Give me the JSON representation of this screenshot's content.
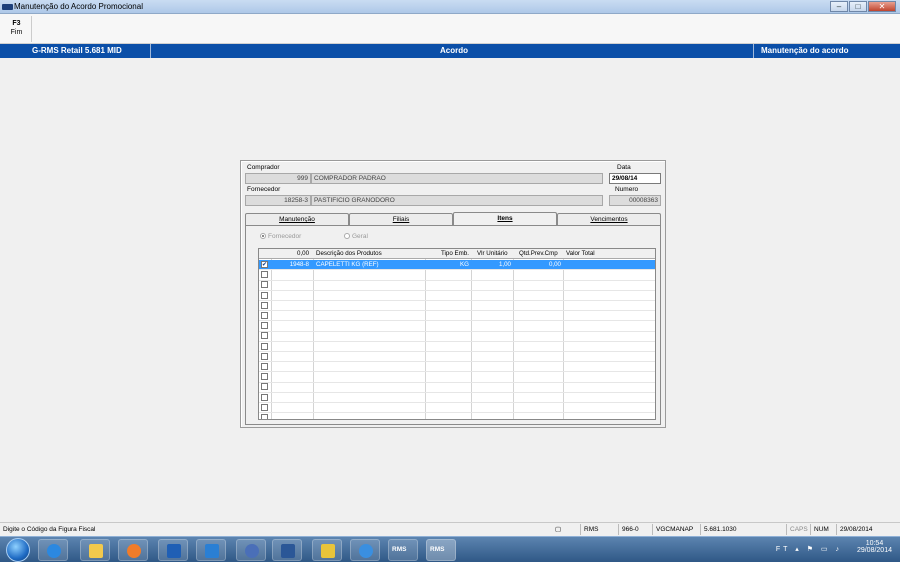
{
  "window": {
    "title": "Manutenção do Acordo Promocional",
    "minimize": "–",
    "maximize": "□",
    "close": "✕"
  },
  "toolbar": {
    "f3_key": "F3",
    "f3_label": "Fim"
  },
  "header": {
    "app": "G-RMS Retail 5.681 MID",
    "center": "Acordo",
    "right": "Manutenção do acordo"
  },
  "form": {
    "comprador_label": "Comprador",
    "comprador_code": "999",
    "comprador_name": "COMPRADOR PADRAO",
    "data_label": "Data",
    "data_value": "29/08/14",
    "fornecedor_label": "Fornecedor",
    "fornecedor_code": "18258-3",
    "fornecedor_name": "PASTIFICIO GRANODORO",
    "numero_label": "Numero",
    "numero_value": "00008363"
  },
  "tabs": [
    {
      "label": "Manutenção"
    },
    {
      "label": "Filiais"
    },
    {
      "label": "Itens"
    },
    {
      "label": "Vencimentos"
    }
  ],
  "radios": {
    "fornecedor": "Fornecedor",
    "geral": "Geral"
  },
  "grid": {
    "headers": {
      "total": "0,00",
      "descricao": "Descrição dos Produtos",
      "tipo": "Tipo Emb.",
      "vlr": "Vlr Unitário",
      "qtd": "Qtd.Prev.Cmp",
      "valor": "Valor Total"
    },
    "rows": [
      {
        "code": "1948-8",
        "descricao": "CAPELETTI KG (REF)",
        "tipo": "KG",
        "vlr": "1,00",
        "qtd": "0,00",
        "valor": "",
        "checked": "✔"
      }
    ]
  },
  "statusbar": {
    "message": "Digite o Código da Figura Fiscal",
    "system": "RMS",
    "code": "966-0",
    "program": "VGCMANAP",
    "version": "5.681.1030",
    "caps": "CAPS",
    "num": "NUM",
    "date": "29/08/2014"
  },
  "taskbar": {
    "rms1": "RMS",
    "rms2": "RMS",
    "tray_ft": "FT",
    "time": "10:54",
    "date": "29/08/2014"
  }
}
